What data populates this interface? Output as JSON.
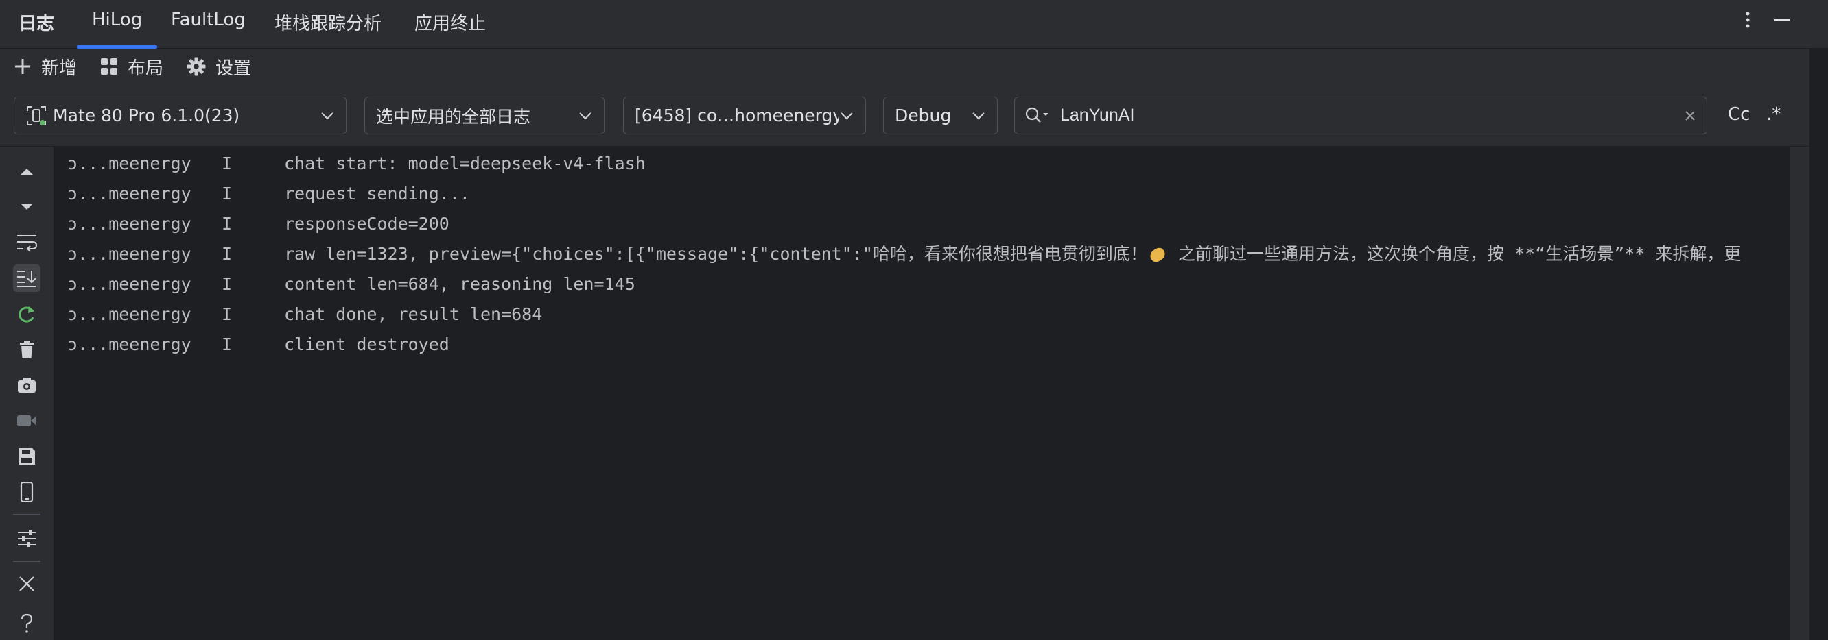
{
  "tabbar": {
    "title": "日志",
    "tabs": [
      {
        "label": "HiLog",
        "active": true
      },
      {
        "label": "FaultLog"
      },
      {
        "label": "堆栈跟踪分析"
      },
      {
        "label": "应用终止"
      }
    ],
    "accent": "#3574f0"
  },
  "toolbar": {
    "add_label": "新增",
    "layout_label": "布局",
    "settings_label": "设置"
  },
  "filters": {
    "device": "Mate 80 Pro 6.1.0(23)",
    "log_scope": "选中应用的全部日志",
    "process": "[6458] co…homeenergy",
    "level": "Debug",
    "search_value": "LanYunAI",
    "case_option": "Cc",
    "regex_option": ".*"
  },
  "log": {
    "lines": [
      {
        "pkg": "ɔ...meenergy",
        "level": "I",
        "msg": "chat start: model=deepseek-v4-flash"
      },
      {
        "pkg": "ɔ...meenergy",
        "level": "I",
        "msg": "request sending..."
      },
      {
        "pkg": "ɔ...meenergy",
        "level": "I",
        "msg": "responseCode=200"
      },
      {
        "pkg": "ɔ...meenergy",
        "level": "I",
        "msg": "raw len=1323, preview={\"choices\":[{\"message\":{\"content\":\"哈哈，看来你很想把省电贯彻到底！",
        "msg_tail": " 之前聊过一些通用方法，这次换个角度，按 **“生活场景”** 来拆解，更"
      },
      {
        "pkg": "ɔ...meenergy",
        "level": "I",
        "msg": "content len=684, reasoning len=145"
      },
      {
        "pkg": "ɔ...meenergy",
        "level": "I",
        "msg": "chat done, result len=684"
      },
      {
        "pkg": "ɔ...meenergy",
        "level": "I",
        "msg": "client destroyed"
      }
    ]
  },
  "leftbar": {
    "icons": [
      "scroll-up-icon",
      "scroll-down-icon",
      "soft-wrap-icon",
      "scroll-to-end-icon",
      "restart-icon",
      "clear-log-icon",
      "screenshot-icon",
      "screen-record-icon",
      "save-icon",
      "device-icon",
      "filter-settings-icon",
      "close-icon",
      "help-icon"
    ],
    "restart_color": "#5fb865"
  }
}
